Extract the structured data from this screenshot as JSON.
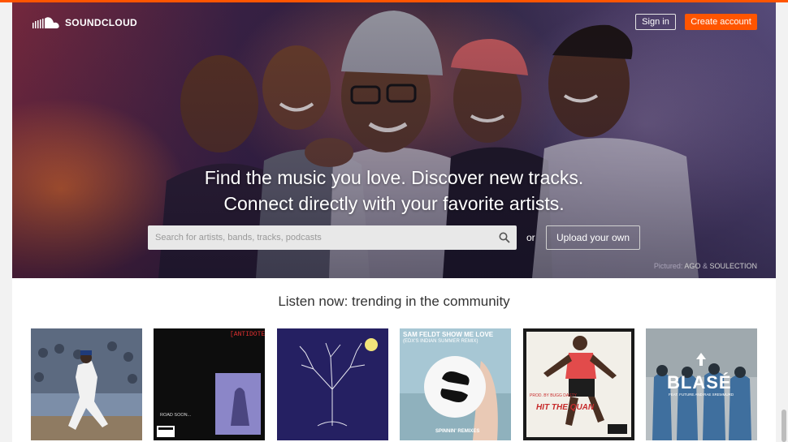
{
  "brand": {
    "name": "SOUNDCLOUD",
    "accent": "#ff5500"
  },
  "header": {
    "sign_in": "Sign in",
    "create_account": "Create account"
  },
  "hero": {
    "headline_line1": "Find the music you love. Discover new tracks.",
    "headline_line2": "Connect directly with your favorite artists.",
    "search_placeholder": "Search for artists, bands, tracks, podcasts",
    "or_text": "or",
    "upload_label": "Upload your own",
    "credit_label": "Pictured:",
    "credit_artist1": "AGO",
    "credit_amp": "&",
    "credit_artist2": "SOULECTION"
  },
  "trending": {
    "title": "Listen now: trending in the community",
    "items": [
      {
        "art": "baseball-player-cover"
      },
      {
        "art": "antidote-cover",
        "caption": "[ANTIDOTE]",
        "sub": "ROAD SOON..."
      },
      {
        "art": "tree-cover"
      },
      {
        "art": "spinnin-remix-cover",
        "caption": "SAM FELDT SHOW ME LOVE",
        "sub": "(EDX'S INDIAN SUMMER REMIX)",
        "footer": "SPINNIN' REMIXES"
      },
      {
        "art": "hit-the-quan-cover",
        "caption": "HIT THE QUAN",
        "sub": "PROD. BY BUGG DASTY"
      },
      {
        "art": "blase-cover",
        "caption": "BLASÉ",
        "sub": "FEAT. FUTURE AND RAE SREMMURD"
      }
    ]
  }
}
